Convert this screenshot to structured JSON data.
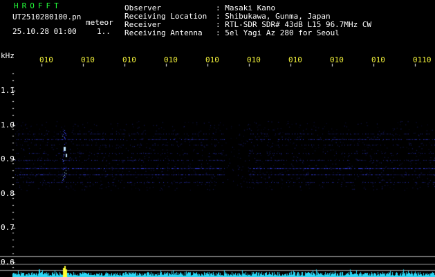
{
  "header": {
    "brand": "HROFFT",
    "filename": "UT2510280100.pn",
    "event_type": "meteor",
    "datetime": "25.10.28 01:00",
    "page_indicator": "1..",
    "info": [
      {
        "label": "Observer",
        "value": ": Masaki Kano"
      },
      {
        "label": "Receiving Location",
        "value": ": Shibukawa, Gunma, Japan"
      },
      {
        "label": "Receiver",
        "value": ": RTL-SDR SDR# 43dB L15 96.7MHz CW"
      },
      {
        "label": "Receiving Antenna",
        "value": ": 5el Yagi Az 280 for Seoul"
      }
    ]
  },
  "time_axis": {
    "ticks": [
      "010",
      "010",
      "010",
      "010",
      "010",
      "010",
      "010",
      "010",
      "010",
      "0110"
    ]
  },
  "freq_axis": {
    "unit": "kHz",
    "ticks": [
      "1.1",
      "1.0",
      "0.9",
      "0.8",
      "0.7",
      "0.6"
    ]
  },
  "colors": {
    "title_green": "#23ff3a",
    "text_white": "#ffffff",
    "axis_yellow": "#f2f23a",
    "signal_blue": "#3a44ff",
    "noise_cyan": "#2ad6f5",
    "meteor_yellow": "#ffff30",
    "separator_gray": "#9a9a9a"
  }
}
